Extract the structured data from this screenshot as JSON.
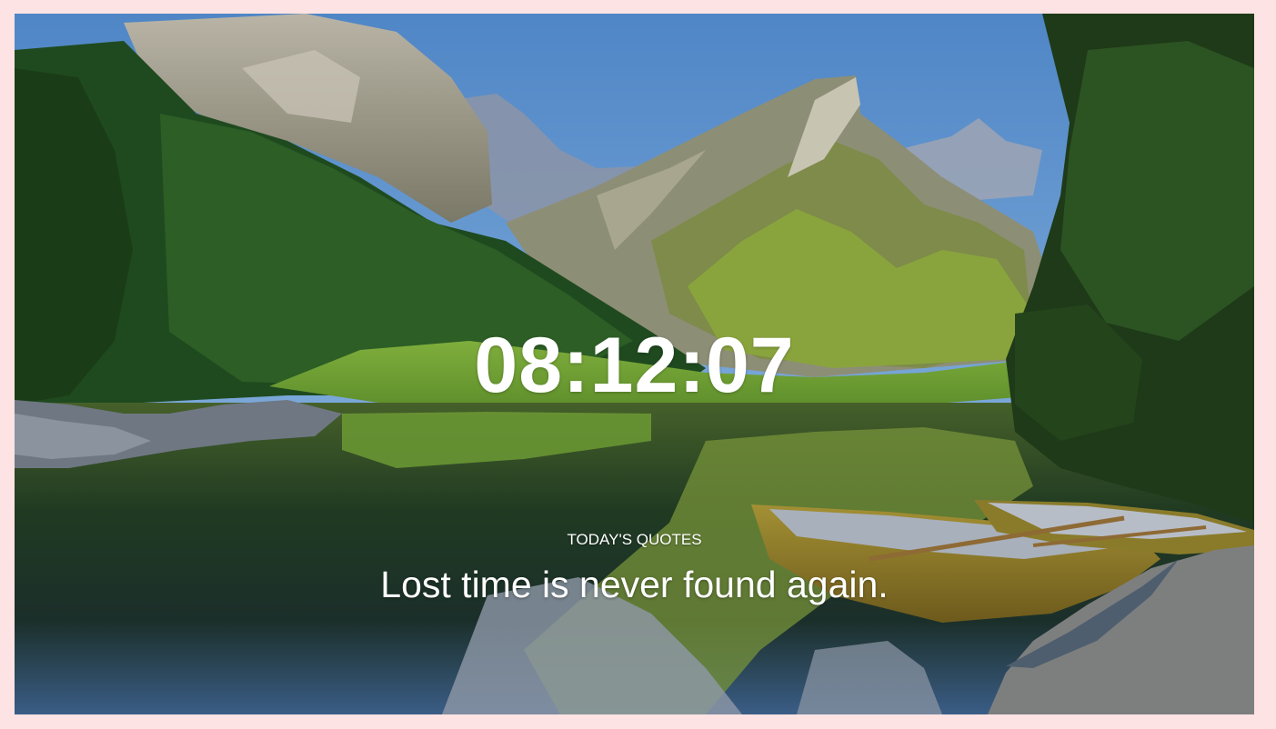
{
  "background": {
    "image_icon": "mountain-lake-boats-image",
    "page_color": "#fde3e3"
  },
  "clock": {
    "time": "08:12:07"
  },
  "quote": {
    "label": "TODAY'S QUOTES",
    "text": "Lost time is never found again."
  }
}
